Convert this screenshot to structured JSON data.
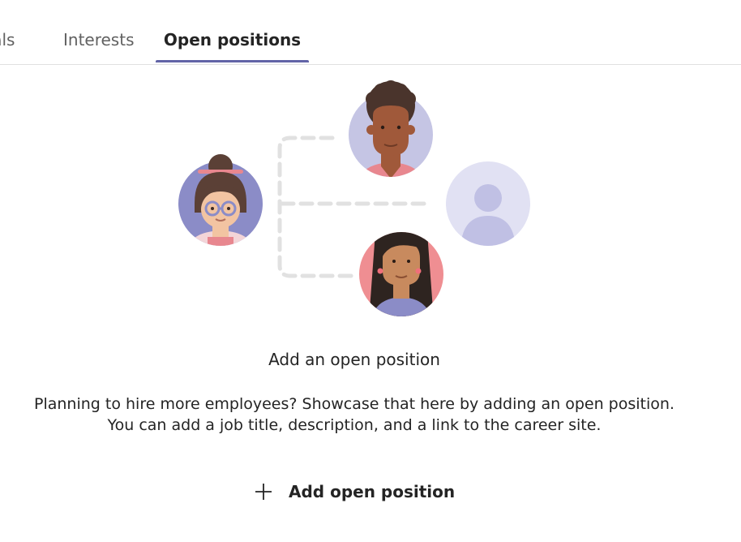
{
  "tabs": [
    {
      "label": "oals"
    },
    {
      "label": "Interests"
    },
    {
      "label": "Open positions",
      "selected": true
    }
  ],
  "empty_state": {
    "title": "Add an open position",
    "description_line1": "Planning to hire more employees? Showcase that here by adding an open position.",
    "description_line2": "You can add a job title, description, and a link to the career site."
  },
  "action": {
    "label": "Add open position",
    "icon": "plus-icon"
  },
  "colors": {
    "accent": "#6264a7",
    "text": "#242424",
    "muted": "#616161"
  }
}
